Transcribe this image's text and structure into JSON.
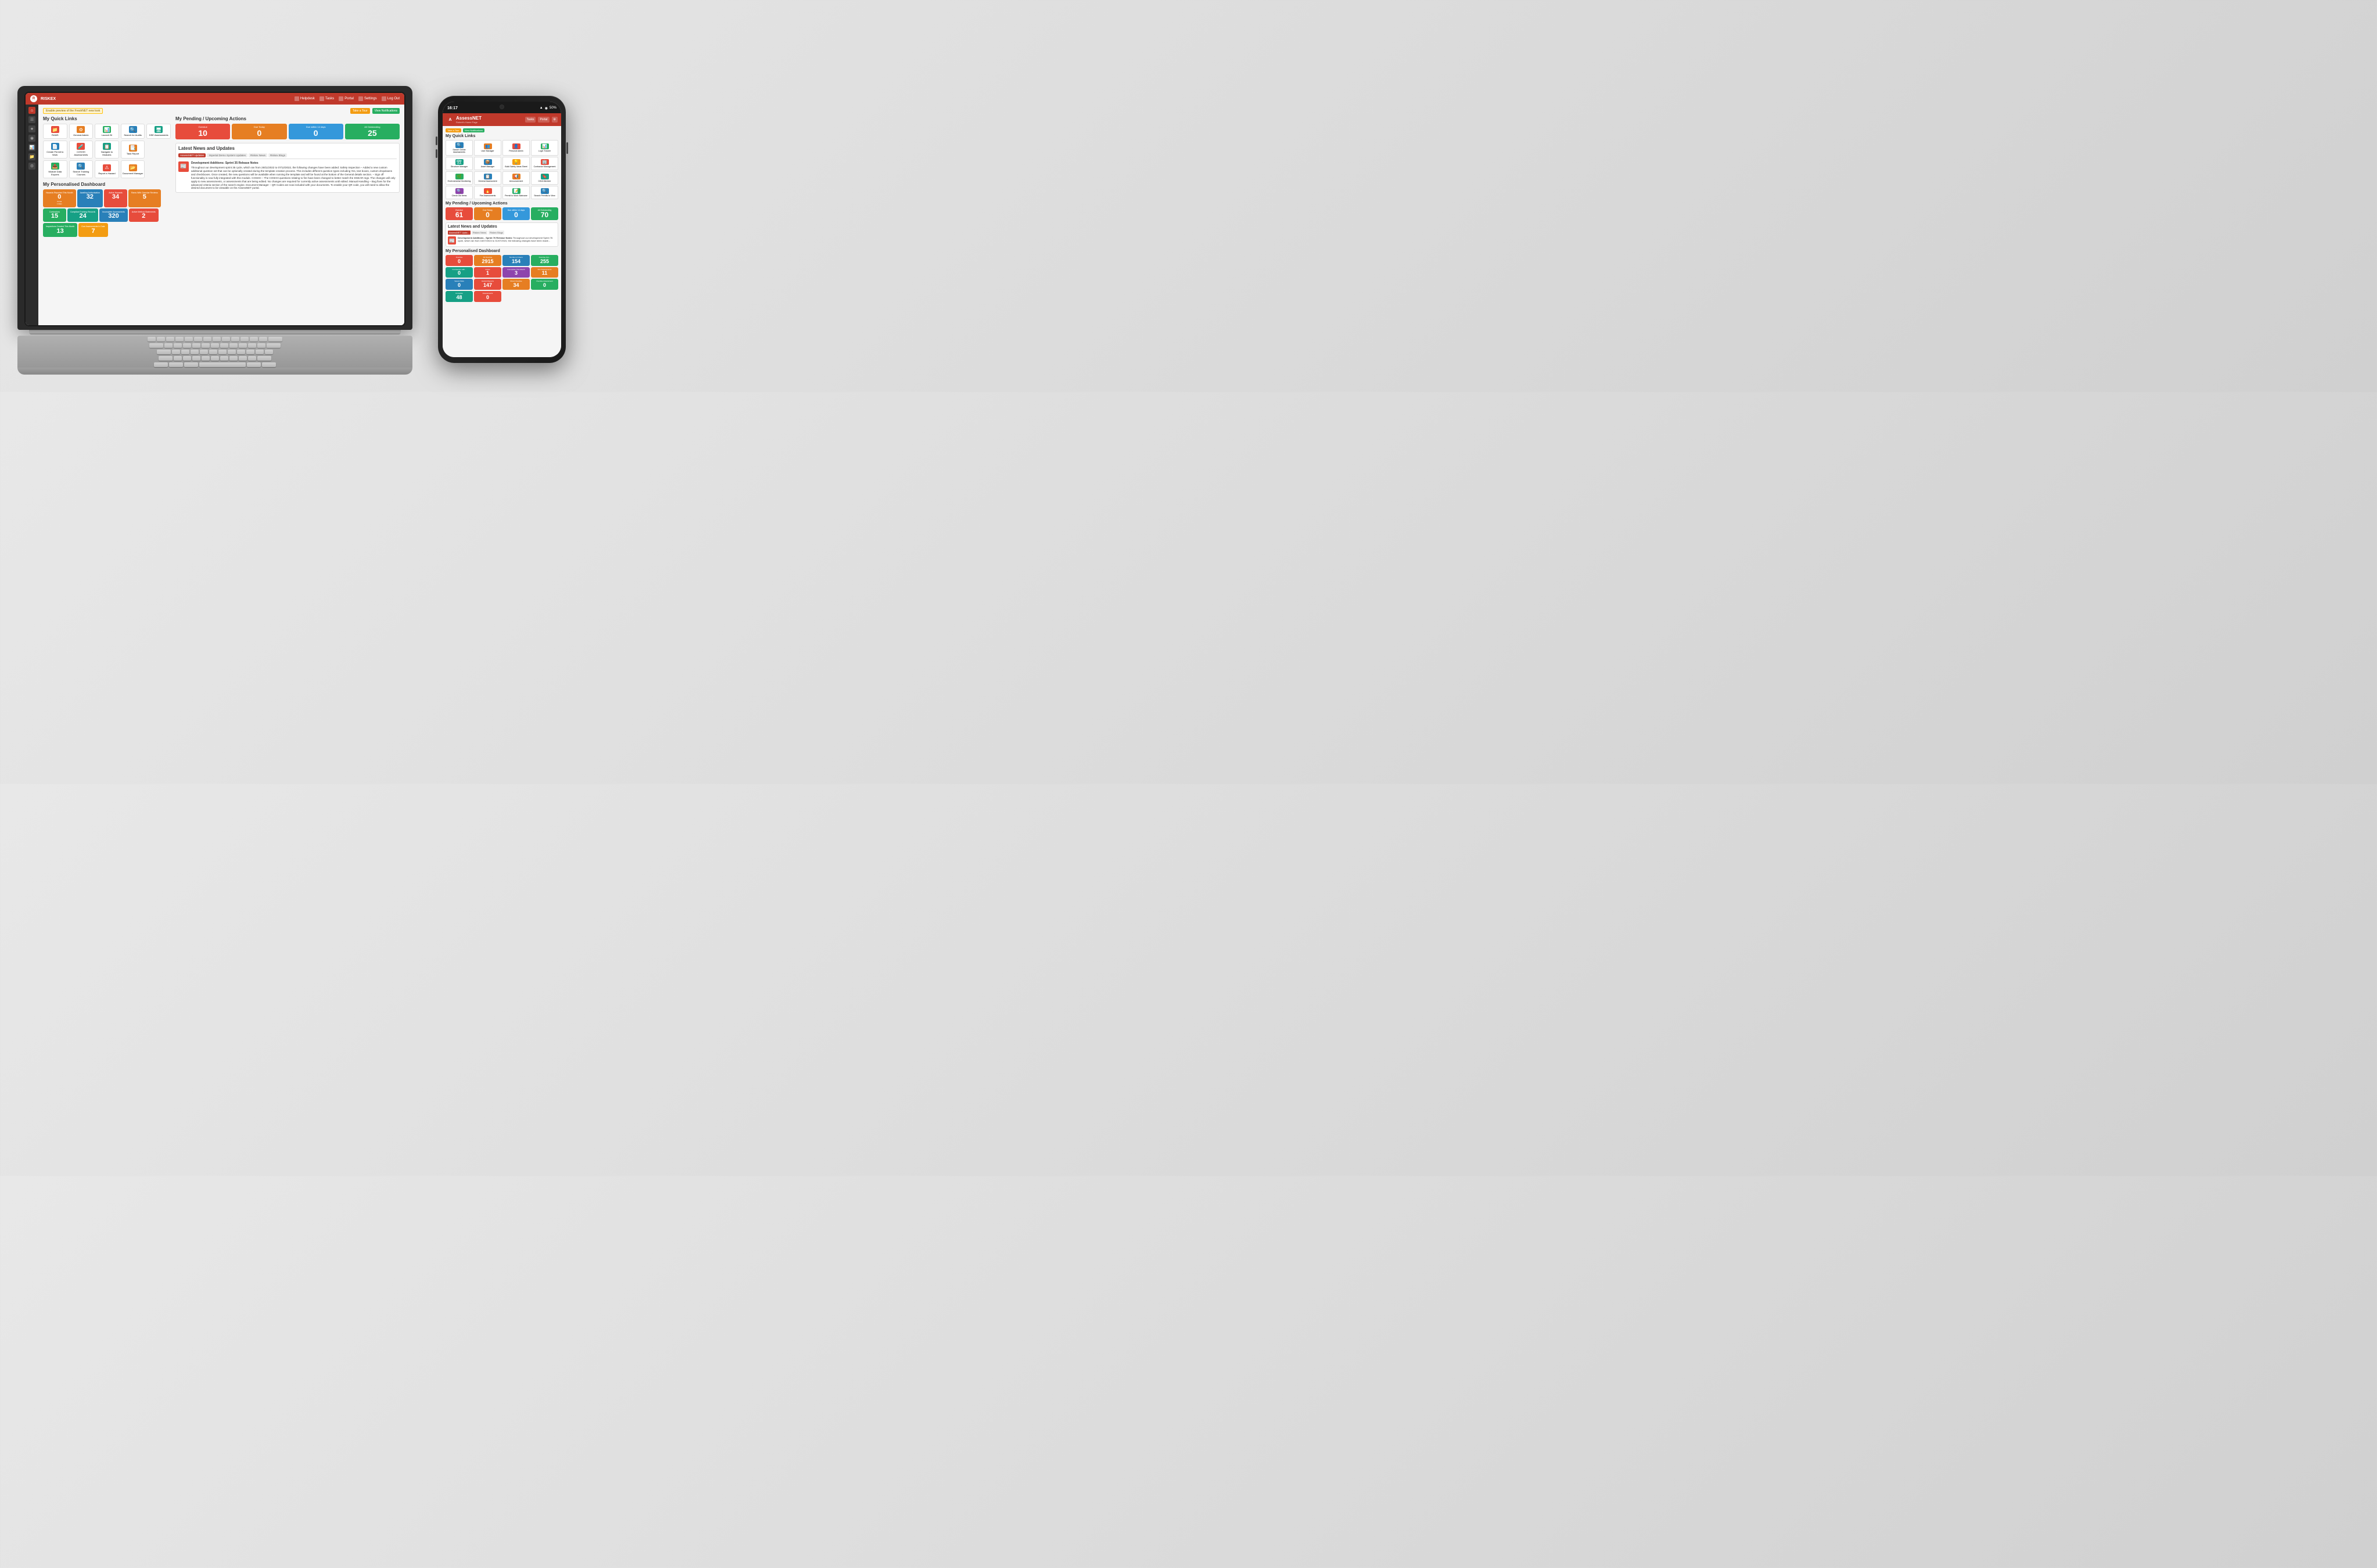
{
  "laptop": {
    "navbar": {
      "logo": "RISKEX",
      "items": [
        "Helpdesk",
        "Tasks",
        "Portal",
        "Settings",
        "Log Out"
      ]
    },
    "top_buttons": {
      "tour": "Take a Tour",
      "notifications": "View Notifications"
    },
    "preview_notice": "Enable preview of the FreshNET new look",
    "section_quick_links": "My Quick Links",
    "quick_links": [
      {
        "label": "RAMS",
        "color": "red",
        "icon": "📁"
      },
      {
        "label": "General Admin",
        "color": "orange",
        "icon": "⚙"
      },
      {
        "label": "Launch BI",
        "color": "green",
        "icon": "📊"
      },
      {
        "label": "Search for Audits",
        "color": "blue",
        "icon": "🔍"
      },
      {
        "label": "DSE Assessments",
        "color": "teal",
        "icon": "🖥"
      },
      {
        "label": "Create Permit to Work",
        "color": "blue",
        "icon": "📄"
      },
      {
        "label": "COSHH Assessments",
        "color": "red",
        "icon": "🧪"
      },
      {
        "label": "Navigate to Modules",
        "color": "teal",
        "icon": "📋"
      },
      {
        "label": "Task Report",
        "color": "orange",
        "icon": "📑"
      },
      {
        "label": "Module Data Exports",
        "color": "green",
        "icon": "📤"
      },
      {
        "label": "Search Training Courses",
        "color": "blue",
        "icon": "🔍"
      },
      {
        "label": "Report a Hazard",
        "color": "red",
        "icon": "⚠"
      },
      {
        "label": "Document Manager",
        "color": "orange",
        "icon": "📂"
      }
    ],
    "section_pending": "My Pending / Upcoming Actions",
    "pending_cards": [
      {
        "label": "Overdue",
        "value": "10",
        "color": "red"
      },
      {
        "label": "Due Today",
        "value": "0",
        "color": "orange"
      },
      {
        "label": "Due within 14 days",
        "value": "0",
        "color": "blue"
      },
      {
        "label": "All Outstanding",
        "value": "25",
        "color": "green"
      }
    ],
    "section_news": "Latest News and Updates",
    "news_tabs": [
      "AssessNET Updates",
      "Imperial Demo System Updates",
      "Riskex News",
      "Riskex Blogs"
    ],
    "news_item": {
      "title": "Development Additions: Sprint 35 Release Notes",
      "body": "Throughout our development sprint 35 cycle, which ran from 28/11/2022 to 07/12/2022, the following changes have been added: Safety Inspection – Added a new custom additional question set that can be optionally created during the template creation process. This includes different question types including Yes, text boxes, custom dropdowns and checkboxes. Once created, the new questions will be available when running the template and will be found at the bottom of the General details section. – Sign off functionality is now fully integrated with this module. COSHH – The COSHH questions relating to fire have been changed to better match the DSEAR regs. The changes will only apply to new assessments, or assessments that are being edited. No changes are required for currently active assessments until edited. Manual Handling – Bug fixes for the advanced criteria section of the search engine. Document Manager – QR Codes are now included with your documents. To enable your QR code, you will need to allow the desired document to be viewable on the AssessNET portal."
    },
    "section_dashboard": "My Personalised Dashboard",
    "dashboard_cards": [
      {
        "label": "Hazards Reported This Month",
        "value": "0",
        "subvalue": "Portal 1 Main",
        "color": "orange"
      },
      {
        "label": "Awaiting Authorisation",
        "value": "32",
        "color": "blue"
      },
      {
        "label": "Active Hazards",
        "value": "34",
        "color": "red"
      },
      {
        "label": "Rams With Overdue Reviews",
        "value": "5",
        "color": "orange"
      },
      {
        "label": "Contractors",
        "value": "15",
        "color": "green"
      },
      {
        "label": "Compliant Training Records",
        "value": "24",
        "color": "teal"
      },
      {
        "label": "Incomplete Assessments",
        "value": "320",
        "color": "blue"
      },
      {
        "label": "Active Method Statements",
        "value": "2",
        "color": "red"
      },
      {
        "label": "Inspections Created This Month",
        "value": "13",
        "color": "green"
      },
      {
        "label": "Due Assessments In Date",
        "value": "7",
        "color": "orange"
      }
    ]
  },
  "phone": {
    "time": "16:17",
    "status_icons": "▲ ◉ 50%",
    "app_name": "AssessNET",
    "app_subtitle": "Robert's Home Page",
    "navbar_items": [
      "Tasks",
      "Portal",
      "Settings"
    ],
    "buttons": {
      "tour": "Take a Tour",
      "notifications": "View Notifications"
    },
    "section_quick_links": "My Quick Links",
    "quick_links": [
      {
        "label": "Search Online Assessments",
        "color": "blue",
        "icon": "🔍"
      },
      {
        "label": "User Manager",
        "color": "orange",
        "icon": "👥"
      },
      {
        "label": "Personal Admin",
        "color": "red",
        "icon": "👤"
      },
      {
        "label": "Login Tracker",
        "color": "green",
        "icon": "📊"
      },
      {
        "label": "Structure Manager",
        "color": "teal",
        "icon": "🏗"
      },
      {
        "label": "Asset Manager",
        "color": "blue",
        "icon": "📦"
      },
      {
        "label": "Build Safety Ideas Sheet",
        "color": "yellow",
        "icon": "💡"
      },
      {
        "label": "Contractor Management",
        "color": "red",
        "icon": "🏢"
      },
      {
        "label": "Environmental Monitoring",
        "color": "green",
        "icon": "🌿"
      },
      {
        "label": "General Assessment",
        "color": "blue",
        "icon": "📋"
      },
      {
        "label": "Announcement",
        "color": "orange",
        "icon": "📢"
      },
      {
        "label": "CIDA Member",
        "color": "teal",
        "icon": "🔖"
      },
      {
        "label": "Check Old Items",
        "color": "purple",
        "icon": "🔍"
      },
      {
        "label": "Fire Assessments",
        "color": "red",
        "icon": "🔥"
      },
      {
        "label": "Permit to Work Staircase",
        "color": "green",
        "icon": "📝"
      },
      {
        "label": "Search Permits to View",
        "color": "blue",
        "icon": "🔍"
      }
    ],
    "section_pending": "My Pending / Upcoming Actions",
    "pending_cards": [
      {
        "label": "Overdue",
        "value": "61",
        "color": "red"
      },
      {
        "label": "Due Today",
        "value": "0",
        "color": "orange"
      },
      {
        "label": "Due within 14 days",
        "value": "0",
        "color": "blue"
      },
      {
        "label": "All Outstanding",
        "value": "70",
        "color": "green"
      }
    ],
    "section_news": "Latest News and Updates",
    "news_tabs": [
      "AssessNET Upda...",
      "Riskex News",
      "Riskex Blogs"
    ],
    "news_item": {
      "title": "Development Additions - Sprint 76 Release Notes",
      "body": "Throughout our development Sprint 76 cycle, which ran from 16/07/2024 to 31/07/2024, the following changes have been made..."
    },
    "section_dashboard": "My Personalised Dashboard",
    "dashboard_cards": [
      {
        "label": "Overdue",
        "value": "0",
        "color": "red"
      },
      {
        "label": "All Overdue",
        "value": "2915",
        "color": "orange"
      },
      {
        "label": "Number of Users",
        "value": "154",
        "color": "blue"
      },
      {
        "label": "Overdue Out...",
        "value": "255",
        "color": "green"
      },
      {
        "label": "Contractors with...",
        "value": "0",
        "color": "teal"
      },
      {
        "label": "Active",
        "value": "1",
        "color": "red"
      },
      {
        "label": "Incomplete This Month Assess...",
        "value": "3",
        "color": "purple"
      },
      {
        "label": "Fire Assessments",
        "value": "11",
        "color": "orange"
      },
      {
        "label": "Vacant Slots",
        "value": "0",
        "color": "blue"
      },
      {
        "label": "Hazard Reports",
        "value": "147",
        "color": "red"
      },
      {
        "label": "Direct Overdue Items",
        "value": "34",
        "color": "orange"
      },
      {
        "label": "Overdue Assessment",
        "value": "0",
        "color": "green"
      },
      {
        "label": "Complete",
        "value": "48",
        "color": "teal"
      },
      {
        "label": "Assessments p",
        "value": "0",
        "color": "red"
      }
    ]
  }
}
